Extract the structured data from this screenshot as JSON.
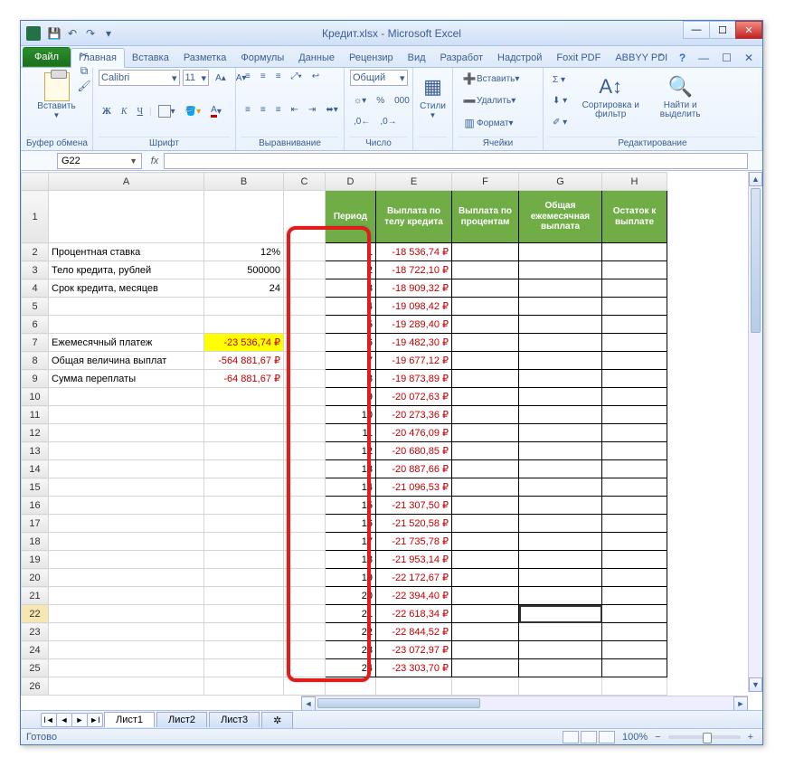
{
  "window": {
    "title": "Кредит.xlsx - Microsoft Excel"
  },
  "ribbon": {
    "file": "Файл",
    "tabs": [
      "Главная",
      "Вставка",
      "Разметка",
      "Формулы",
      "Данные",
      "Рецензир",
      "Вид",
      "Разработ",
      "Надстрой",
      "Foxit PDF",
      "ABBYY PDI"
    ],
    "active_tab": 0,
    "groups": {
      "clipboard": {
        "label": "Буфер обмена",
        "paste": "Вставить"
      },
      "font": {
        "label": "Шрифт",
        "name": "Calibri",
        "size": "11"
      },
      "alignment": {
        "label": "Выравнивание"
      },
      "number": {
        "label": "Число",
        "format": "Общий"
      },
      "styles": {
        "label": "",
        "btn": "Стили"
      },
      "cells": {
        "label": "Ячейки",
        "insert": "Вставить",
        "delete": "Удалить",
        "format": "Формат"
      },
      "editing": {
        "label": "Редактирование",
        "sort": "Сортировка и фильтр",
        "find": "Найти и выделить"
      }
    }
  },
  "formula_bar": {
    "cell_ref": "G22",
    "formula": ""
  },
  "columns": [
    "A",
    "B",
    "C",
    "D",
    "E",
    "F",
    "G",
    "H"
  ],
  "headers": {
    "D": "Период",
    "E": "Выплата по телу кредита",
    "F": "Выплата по процентам",
    "G": "Общая ежемесячная выплата",
    "H": "Остаток к выплате"
  },
  "left_labels": {
    "r2": "Процентная ставка",
    "r3": "Тело кредита, рублей",
    "r4": "Срок кредита, месяцев",
    "r7": "Ежемесячный платеж",
    "r8": "Общая величина выплат",
    "r9": "Сумма переплаты"
  },
  "left_values": {
    "r2": "12%",
    "r3": "500000",
    "r4": "24",
    "r7": "-23 536,74 ₽",
    "r8": "-564 881,67 ₽",
    "r9": "-64 881,67 ₽"
  },
  "periods": [
    1,
    2,
    3,
    4,
    5,
    6,
    7,
    8,
    9,
    10,
    11,
    12,
    13,
    14,
    15,
    16,
    17,
    18,
    19,
    20,
    21,
    22,
    23,
    24
  ],
  "col_e": [
    "-18 536,74 ₽",
    "-18 722,10 ₽",
    "-18 909,32 ₽",
    "-19 098,42 ₽",
    "-19 289,40 ₽",
    "-19 482,30 ₽",
    "-19 677,12 ₽",
    "-19 873,89 ₽",
    "-20 072,63 ₽",
    "-20 273,36 ₽",
    "-20 476,09 ₽",
    "-20 680,85 ₽",
    "-20 887,66 ₽",
    "-21 096,53 ₽",
    "-21 307,50 ₽",
    "-21 520,58 ₽",
    "-21 735,78 ₽",
    "-21 953,14 ₽",
    "-22 172,67 ₽",
    "-22 394,40 ₽",
    "-22 618,34 ₽",
    "-22 844,52 ₽",
    "-23 072,97 ₽",
    "-23 303,70 ₽"
  ],
  "selected_cell": "G22",
  "sheets": {
    "tabs": [
      "Лист1",
      "Лист2",
      "Лист3"
    ],
    "active": 0
  },
  "status": {
    "ready": "Готово",
    "zoom": "100%"
  }
}
